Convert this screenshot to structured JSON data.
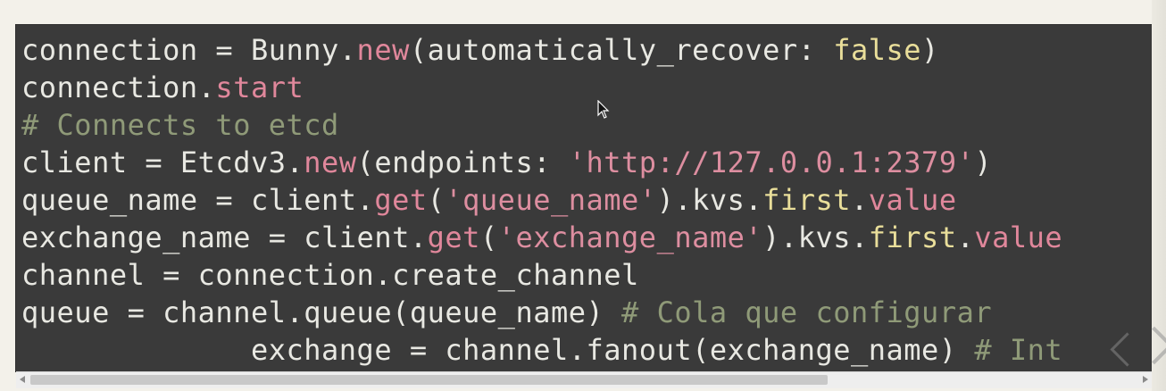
{
  "editor": {
    "lines": [
      [
        {
          "text": "connection = Bunny.",
          "type": "ident"
        },
        {
          "text": "new",
          "type": "method"
        },
        {
          "text": "(automatically_recover: ",
          "type": "ident"
        },
        {
          "text": "false",
          "type": "bool"
        },
        {
          "text": ")",
          "type": "ident"
        }
      ],
      [
        {
          "text": "connection.",
          "type": "ident"
        },
        {
          "text": "start",
          "type": "method"
        }
      ],
      [
        {
          "text": "# Connects to etcd",
          "type": "comment"
        }
      ],
      [
        {
          "text": "client = Etcdv3.",
          "type": "ident"
        },
        {
          "text": "new",
          "type": "method"
        },
        {
          "text": "(endpoints: ",
          "type": "ident"
        },
        {
          "text": "'http://127.0.0.1:2379'",
          "type": "string"
        },
        {
          "text": ")",
          "type": "ident"
        }
      ],
      [
        {
          "text": "queue_name = client.",
          "type": "ident"
        },
        {
          "text": "get",
          "type": "method"
        },
        {
          "text": "(",
          "type": "ident"
        },
        {
          "text": "'queue_name'",
          "type": "string"
        },
        {
          "text": ").kvs.",
          "type": "ident"
        },
        {
          "text": "first",
          "type": "bool"
        },
        {
          "text": ".",
          "type": "ident"
        },
        {
          "text": "value",
          "type": "method"
        }
      ],
      [
        {
          "text": "exchange_name = client.",
          "type": "ident"
        },
        {
          "text": "get",
          "type": "method"
        },
        {
          "text": "(",
          "type": "ident"
        },
        {
          "text": "'exchange_name'",
          "type": "string"
        },
        {
          "text": ").kvs.",
          "type": "ident"
        },
        {
          "text": "first",
          "type": "bool"
        },
        {
          "text": ".",
          "type": "ident"
        },
        {
          "text": "value",
          "type": "method"
        }
      ],
      [
        {
          "text": "channel = connection.create_channel",
          "type": "ident"
        }
      ],
      [
        {
          "text": "queue = channel.queue(queue_name) ",
          "type": "ident"
        },
        {
          "text": "# Cola que configurar",
          "type": "comment"
        }
      ],
      [
        {
          "text": "             exchange = channel.fanout(exchange_name) ",
          "type": "ident"
        },
        {
          "text": "# Int",
          "type": "comment"
        }
      ]
    ]
  },
  "scrollbar": {
    "horizontal_position": 0.0,
    "visible_fraction": 0.72
  },
  "colors": {
    "background": "#f3f1ea",
    "code_background": "#3a3a3a",
    "identifier": "#e8e8e2",
    "method": "#e0879b",
    "string": "#dd8ea0",
    "keyword_bool": "#e9de9a",
    "comment": "#8f9a78"
  },
  "icons": {
    "cursor": "mouse-pointer-icon",
    "next": "chevron-right-icon",
    "scroll_left": "scroll-left-arrow-icon",
    "scroll_right": "scroll-right-arrow-icon"
  }
}
